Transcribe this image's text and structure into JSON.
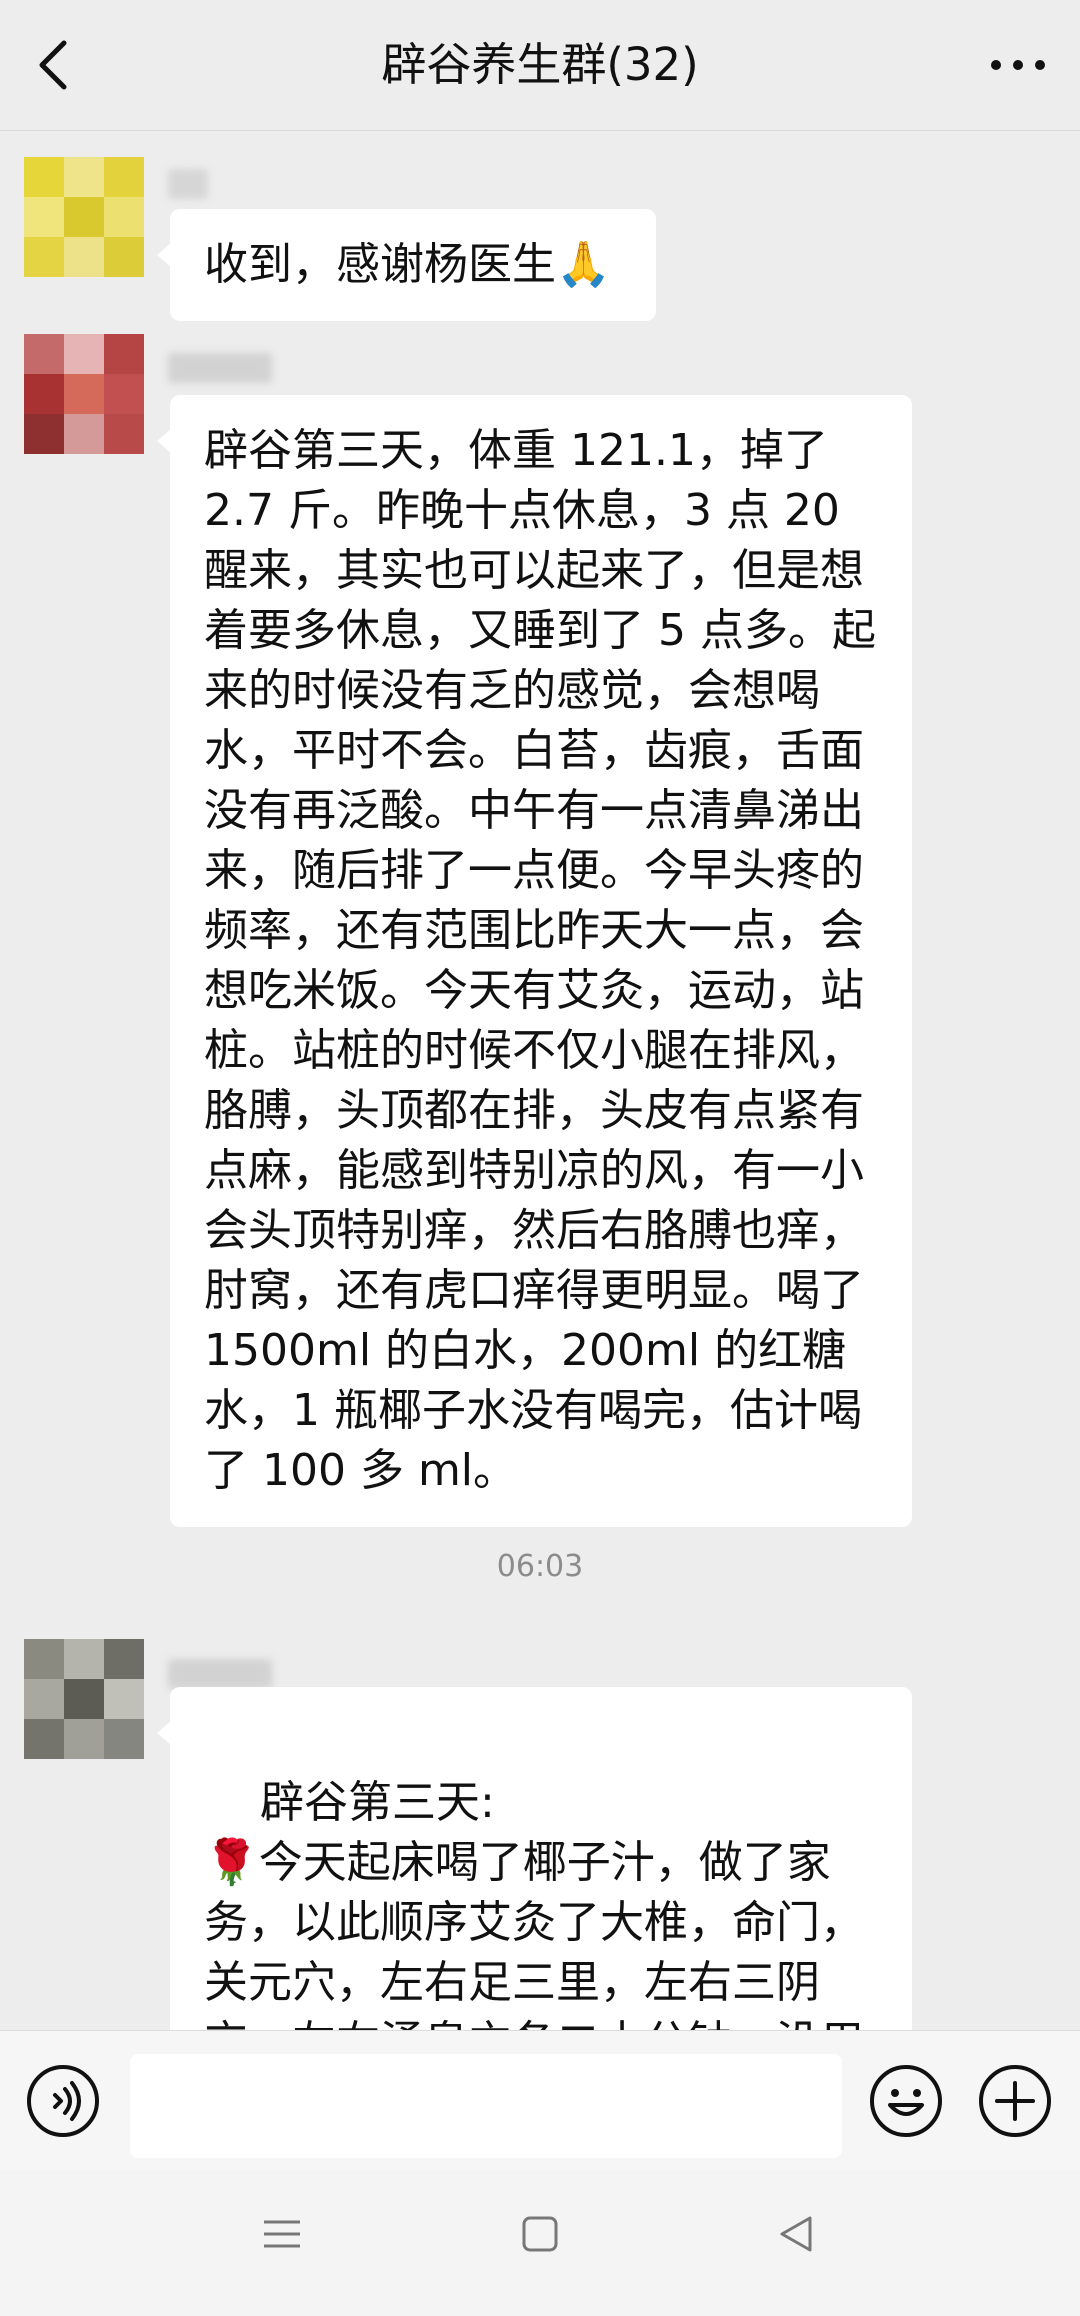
{
  "header": {
    "title": "辟谷养生群(32)",
    "back_icon": "chevron-left-icon",
    "more_icon": "more-dots-icon"
  },
  "messages": [
    {
      "text": "收到，感谢杨医生🙏",
      "avatar_colors": [
        "#e8da3c",
        "#efe07a",
        "#d9c92b"
      ]
    },
    {
      "text": "辟谷第三天，体重 121.1，掉了 2.7 斤。昨晚十点休息，3 点 20 醒来，其实也可以起来了，但是想着要多休息，又睡到了 5 点多。起来的时候没有乏的感觉，会想喝水，平时不会。白苔，齿痕，舌面没有再泛酸。中午有一点清鼻涕出来，随后排了一点便。今早头疼的频率，还有范围比昨天大一点，会想吃米饭。今天有艾灸，运动，站桩。站桩的时候不仅小腿在排风，胳膊，头顶都在排，头皮有点紧有点麻，能感到特别凉的风，有一小会头顶特别痒，然后右胳膊也痒，肘窝，还有虎口痒得更明显。喝了 1500ml 的白水，200ml 的红糖水，1 瓶椰子水没有喝完，估计喝了 100 多 ml。",
      "avatar_colors": [
        "#b03a3a",
        "#d9a0a0",
        "#8e2a2a"
      ]
    },
    {
      "timestamp": "06:03"
    },
    {
      "text": "辟谷第三天:\n🌹今天起床喝了椰子汁，做了家务，以此顺序艾灸了大椎，命门，关元穴，左右足三里，左右三阴交，左右涌泉穴各二十分钟，没用完的多又条了儿子的中脘等穴",
      "avatar_colors": [
        "#7a7a70",
        "#b0b0a8",
        "#55554e"
      ]
    }
  ],
  "input_bar": {
    "placeholder": "",
    "voice_icon": "voice-icon",
    "emoji_icon": "emoji-icon",
    "plus_icon": "plus-icon"
  },
  "system_nav": {
    "icons": [
      "menu-icon",
      "home-icon",
      "back-triangle-icon"
    ]
  },
  "colors": {
    "background": "#ededed",
    "bubble": "#ffffff",
    "timestamp": "#8c8c8c"
  }
}
